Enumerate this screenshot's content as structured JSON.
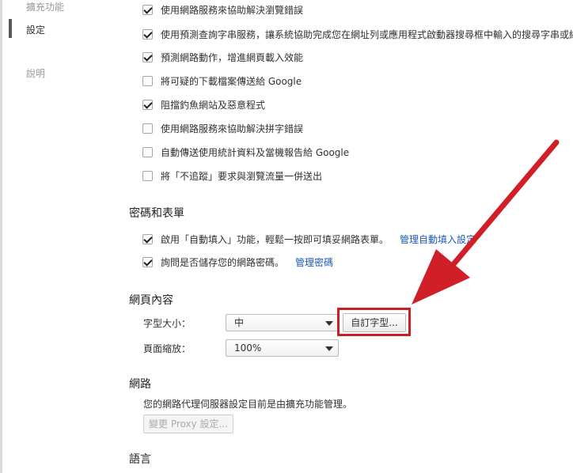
{
  "sidebar": {
    "items": [
      {
        "label": "擴充功能"
      },
      {
        "label": "設定"
      },
      {
        "label": "說明"
      }
    ]
  },
  "privacy": {
    "options": [
      {
        "label": "使用網路服務來協助解決瀏覽錯誤",
        "checked": true
      },
      {
        "label": "使用預測查詢字串服務，讓系統協助完成您在網址列或應用程式啟動器搜尋框中輸入的搜尋字串或網",
        "checked": true
      },
      {
        "label": "預測網路動作，增進網頁載入效能",
        "checked": true
      },
      {
        "label": "將可疑的下載檔案傳送給 Google",
        "checked": false
      },
      {
        "label": "阻擋釣魚網站及惡意程式",
        "checked": true
      },
      {
        "label": "使用網路服務來協助解決拼字錯誤",
        "checked": false
      },
      {
        "label": "自動傳送使用統計資料及當機報告給 Google",
        "checked": false
      },
      {
        "label": "將「不追蹤」要求與瀏覽流量一併送出",
        "checked": false
      }
    ]
  },
  "passwords": {
    "title": "密碼和表單",
    "autofill_label": "啟用「自動填入」功能，輕鬆一按即可填妥網路表單。",
    "autofill_link": "管理自動填入設定",
    "save_label": "詢問是否儲存您的網路密碼。",
    "save_link": "管理密碼"
  },
  "web_content": {
    "title": "網頁內容",
    "font_size_label": "字型大小：",
    "font_size_value": "中",
    "custom_fonts_button": "自訂字型...",
    "zoom_label": "頁面縮放：",
    "zoom_value": "100%"
  },
  "network": {
    "title": "網路",
    "description": "您的網路代理伺服器設定目前是由擴充功能管理。",
    "proxy_button": "變更 Proxy 設定..."
  },
  "language": {
    "title": "語言"
  },
  "colors": {
    "annotation_red": "#d01f26",
    "link_blue": "#1c5ab5"
  }
}
